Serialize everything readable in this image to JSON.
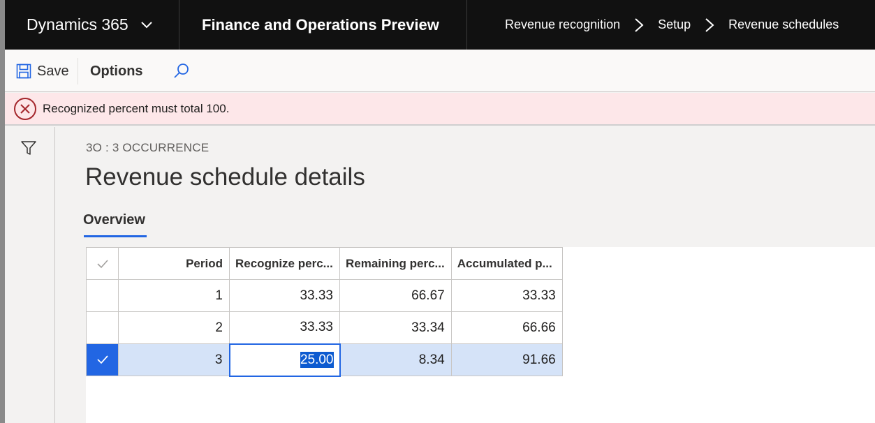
{
  "navbar": {
    "brand": "Dynamics 365",
    "app_name": "Finance and Operations Preview",
    "breadcrumbs": [
      "Revenue recognition",
      "Setup",
      "Revenue schedules"
    ]
  },
  "actionbar": {
    "save_label": "Save",
    "options_label": "Options"
  },
  "message": {
    "type": "error",
    "text": "Recognized percent must total 100."
  },
  "page": {
    "record_caption": "3O : 3 OCCURRENCE",
    "title": "Revenue schedule details",
    "tab": "Overview"
  },
  "grid": {
    "columns": [
      "Period",
      "Recognize perc...",
      "Remaining perc...",
      "Accumulated p..."
    ],
    "rows": [
      {
        "period": "1",
        "recognize": "33.33",
        "remaining": "66.67",
        "accumulated": "33.33"
      },
      {
        "period": "2",
        "recognize": "33.33",
        "remaining": "33.34",
        "accumulated": "66.66"
      },
      {
        "period": "3",
        "recognize": "25.00",
        "remaining": "8.34",
        "accumulated": "91.66"
      }
    ],
    "selected_row": 3
  },
  "colors": {
    "navbar_bg": "#111111",
    "accent": "#2266e3",
    "error_bg": "#fde7e9",
    "error_icon": "#a4262c",
    "selected_row_bg": "#d5e3f8"
  }
}
